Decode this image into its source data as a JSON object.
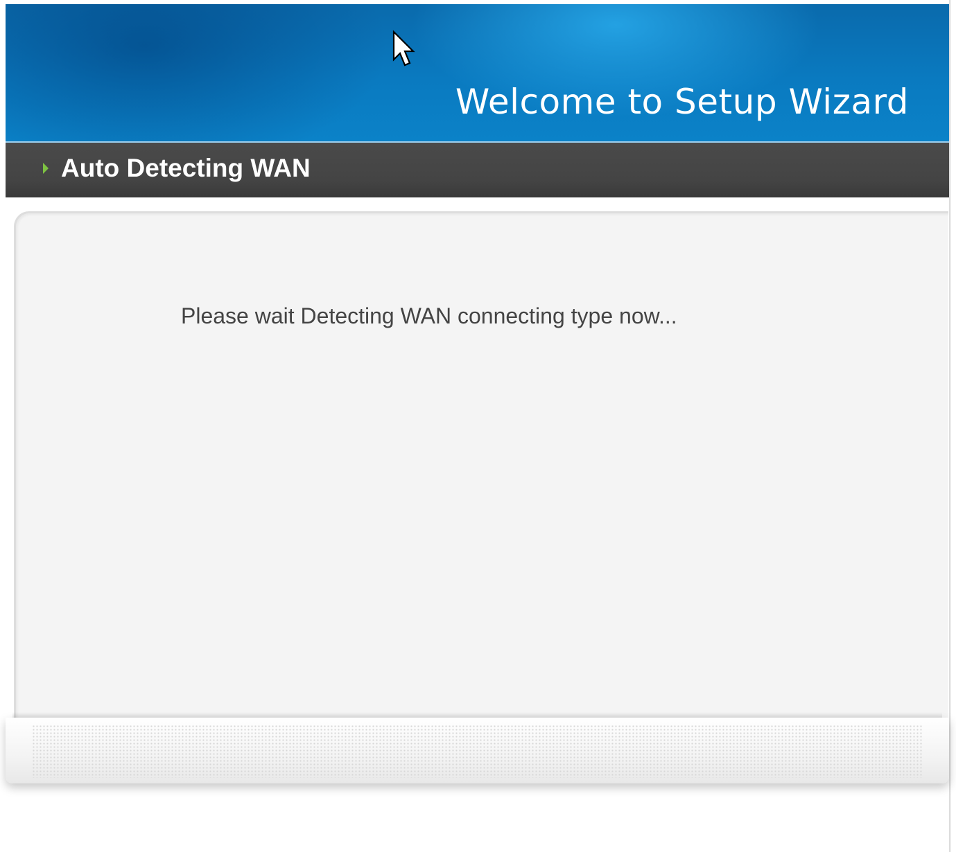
{
  "banner": {
    "title": "Welcome to Setup Wizard"
  },
  "section": {
    "title": "Auto Detecting WAN",
    "arrow_icon": "triangle-right-icon"
  },
  "main": {
    "message": "Please wait Detecting WAN connecting type now..."
  },
  "colors": {
    "banner_blue": "#0a7ac0",
    "section_bar": "#444444",
    "arrow_green": "#7dc142",
    "panel_bg": "#f4f4f4",
    "message_text": "#444444"
  }
}
